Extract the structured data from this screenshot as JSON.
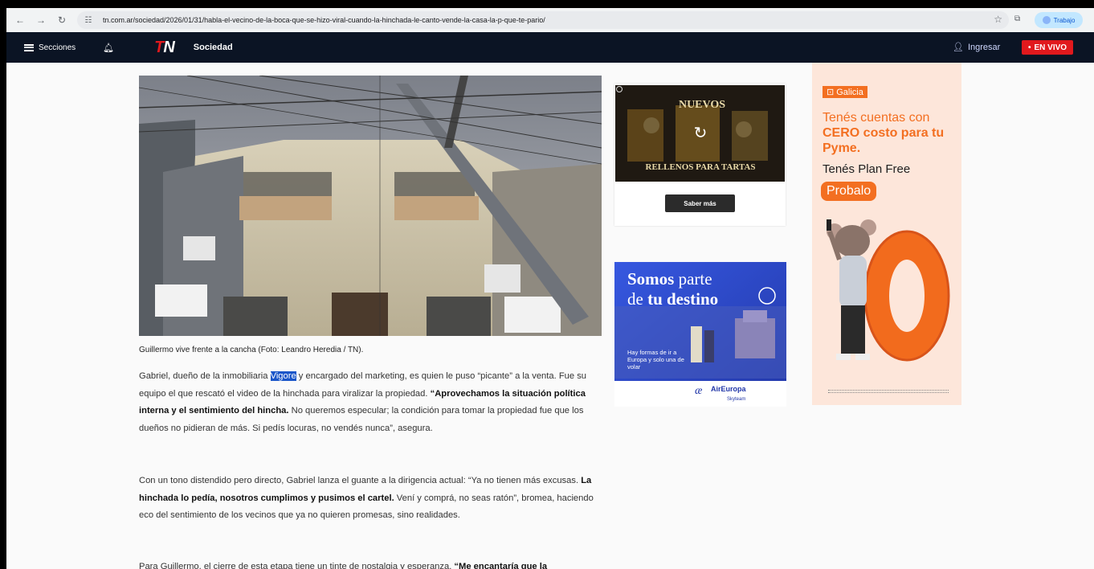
{
  "browser": {
    "url": "tn.com.ar/sociedad/2026/01/31/habla-el-vecino-de-la-boca-que-se-hizo-viral-cuando-la-hinchada-le-canto-vende-la-casa-la-p-que-te-pario/",
    "profile_label": "Trabajo"
  },
  "header": {
    "menu_label": "Secciones",
    "logo_t": "T",
    "logo_n": "N",
    "section": "Sociedad",
    "login_label": "Ingresar",
    "live_label": "EN VIVO"
  },
  "article": {
    "caption": "Guillermo vive frente a la cancha (Foto: Leandro Heredia / TN).",
    "p1_a": "Gabriel, dueño de la inmobiliaria ",
    "p1_hl": "Vigore",
    "p1_b": " y encargado del marketing, es quien le puso “picante” a la venta. Fue su equipo el que rescató el video de la hinchada para viralizar la propiedad. ",
    "p1_bold": "“Aprovechamos la situación política interna y el sentimiento del hincha.",
    "p1_c": " No queremos especular; la condición para tomar la propiedad fue que los dueños no pidieran de más. Si pedís locuras, no vendés nunca”, asegura.",
    "p2_a": "Con un tono distendido pero directo, Gabriel lanza el guante a la dirigencia actual: “Ya no tienen más excusas. ",
    "p2_bold": "La hinchada lo pedía, nosotros cumplimos y pusimos el cartel.",
    "p2_b": " Vení y comprá, no seas ratón”, bromea, haciendo eco del sentimiento de los vecinos que ya no quieren promesas, sino realidades.",
    "p3_a": "Para Guillermo, el cierre de esta etapa tiene un tinte de nostalgia y esperanza. ",
    "p3_bold": "“Me encantaría que la"
  },
  "ads": {
    "ad1_title": "NUEVOS",
    "ad1_sub": "RELLENOS PARA TARTAS",
    "ad1_button": "Saber más",
    "ad2_line1a": "Somos",
    "ad2_line1b": " parte",
    "ad2_line2a": "de ",
    "ad2_line2b": "tu destino",
    "ad2_body": "Hay formas de ir a Europa y solo una de volar",
    "ad2_brand": "AirEuropa",
    "ad2_brand_sub": "Skyteam",
    "ad3_brand": "Galicia",
    "ad3_line1a": "Tenés cuentas con ",
    "ad3_line1b": "CERO costo para tu Pyme.",
    "ad3_line2": "Tenés Plan Free",
    "ad3_cta": "Probalo"
  }
}
